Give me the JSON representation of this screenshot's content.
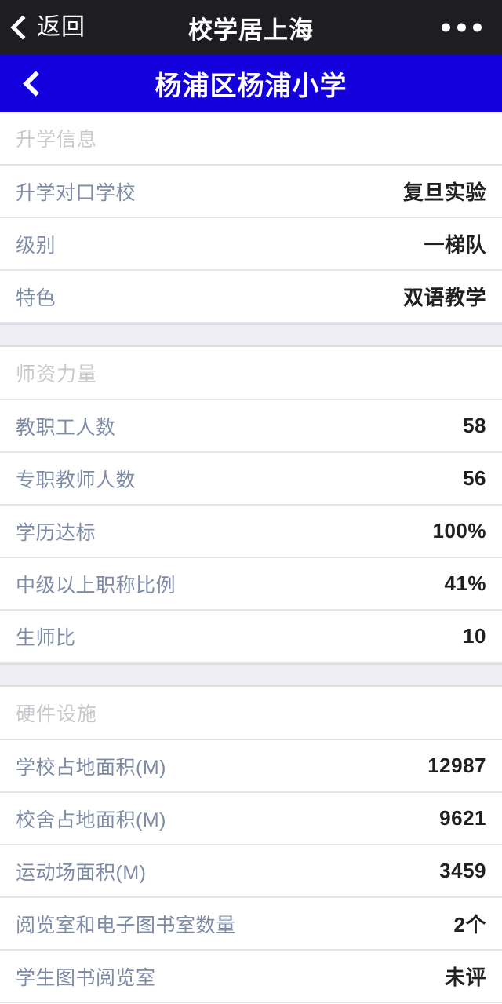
{
  "browser_bar": {
    "back_label": "返回",
    "back_icon": "chevron-left-icon",
    "title": "校学居上海",
    "menu_icon": "more-dots-icon",
    "background_color": "#1e1e22",
    "text_color": "#ffffff"
  },
  "page_header": {
    "back_icon": "chevron-left-icon",
    "title": "杨浦区杨浦小学",
    "background_color": "#1400dd",
    "text_color": "#ffffff"
  },
  "theme": {
    "label_color": "#7e8ba6",
    "value_color": "#202020",
    "section_header_color": "#c9c9cd",
    "gap_color": "#eeeef4",
    "divider_color": "#e6e6ea"
  },
  "sections": [
    {
      "title": "升学信息",
      "rows": [
        {
          "label": "升学对口学校",
          "value": "复旦实验"
        },
        {
          "label": "级别",
          "value": "一梯队"
        },
        {
          "label": "特色",
          "value": "双语教学"
        }
      ]
    },
    {
      "title": "师资力量",
      "rows": [
        {
          "label": "教职工人数",
          "value": "58"
        },
        {
          "label": "专职教师人数",
          "value": "56"
        },
        {
          "label": "学历达标",
          "value": "100%"
        },
        {
          "label": "中级以上职称比例",
          "value": "41%"
        },
        {
          "label": "生师比",
          "value": "10"
        }
      ]
    },
    {
      "title": "硬件设施",
      "rows": [
        {
          "label": "学校占地面积(M)",
          "value": "12987"
        },
        {
          "label": "校舍占地面积(M)",
          "value": "9621"
        },
        {
          "label": "运动场面积(M)",
          "value": "3459"
        },
        {
          "label": "阅览室和电子图书室数量",
          "value": "2个"
        },
        {
          "label": "学生图书阅览室",
          "value": "未评"
        }
      ]
    }
  ]
}
